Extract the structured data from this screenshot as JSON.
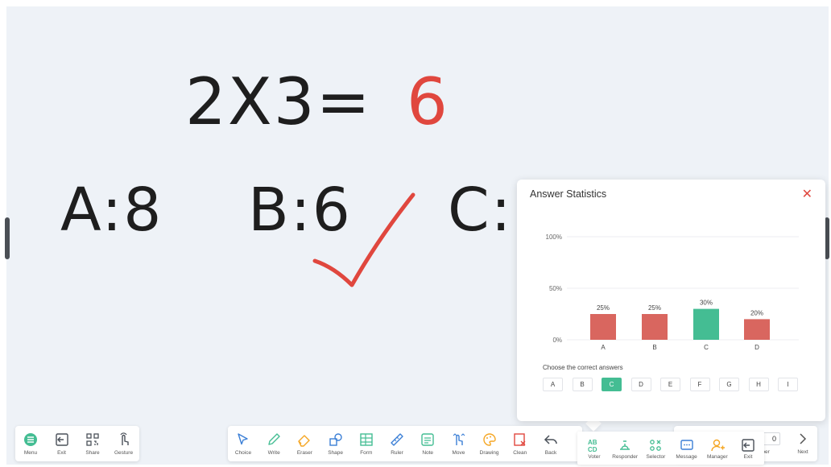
{
  "board": {
    "equation_left": "2X3=",
    "equation_answer": "6",
    "option_a": "A:8",
    "option_b": "B:6",
    "option_c": "C:",
    "colors": {
      "ink": "#1e1e1e",
      "red": "#e0473e",
      "accent": "#44bd93"
    }
  },
  "panel": {
    "title": "Answer Statistics",
    "close_icon": "close-icon",
    "choose_label": "Choose the correct answers",
    "answers": [
      "A",
      "B",
      "C",
      "D",
      "E",
      "F",
      "G",
      "H",
      "I"
    ],
    "selected_answer": "C"
  },
  "chart_data": {
    "type": "bar",
    "categories": [
      "A",
      "B",
      "C",
      "D"
    ],
    "values": [
      25,
      25,
      30,
      20
    ],
    "value_labels": [
      "25%",
      "25%",
      "30%",
      "20%"
    ],
    "correct": "C",
    "ylim": [
      0,
      100
    ],
    "ytick_labels": [
      "0%",
      "50%",
      "100%"
    ],
    "yticks": [
      0,
      50,
      100
    ],
    "grid": true,
    "bar_colors": {
      "default": "#d9665f",
      "correct": "#44bd93"
    }
  },
  "toolbar_left": [
    {
      "label": "Menu",
      "icon": "menu-icon"
    },
    {
      "label": "Exit",
      "icon": "exit-icon"
    },
    {
      "label": "Share",
      "icon": "share-icon"
    },
    {
      "label": "Gesture",
      "icon": "gesture-icon"
    }
  ],
  "toolbar_main": [
    {
      "label": "Choice",
      "icon": "choice-icon"
    },
    {
      "label": "Write",
      "icon": "write-icon"
    },
    {
      "label": "Eraser",
      "icon": "eraser-icon"
    },
    {
      "label": "Shape",
      "icon": "shape-icon"
    },
    {
      "label": "Form",
      "icon": "form-icon"
    },
    {
      "label": "Ruler",
      "icon": "ruler-icon"
    },
    {
      "label": "Note",
      "icon": "note-icon"
    },
    {
      "label": "Move",
      "icon": "move-icon"
    },
    {
      "label": "Drawing",
      "icon": "drawing-icon"
    },
    {
      "label": "Clean",
      "icon": "clean-icon"
    },
    {
      "label": "Back",
      "icon": "back-icon"
    }
  ],
  "toolbar_right": {
    "page_number_partial": "0",
    "page_label_partial": "mber",
    "next_label": "Next"
  },
  "interaction_bar": [
    {
      "label": "Voter",
      "icon": "voter-icon"
    },
    {
      "label": "Responder",
      "icon": "responder-icon"
    },
    {
      "label": "Selector",
      "icon": "selector-icon"
    },
    {
      "label": "Message",
      "icon": "message-icon"
    },
    {
      "label": "Manager",
      "icon": "manager-icon"
    },
    {
      "label": "Exit",
      "icon": "exit-icon"
    }
  ]
}
